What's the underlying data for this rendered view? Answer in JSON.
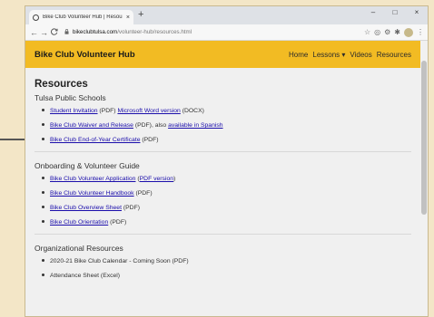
{
  "browser": {
    "tab_title": "Bike Club Volunteer Hub | Resou",
    "tab_close": "×",
    "new_tab": "+",
    "url_host": "bikeclubtulsa.com",
    "url_path": "/volunteer-hub/resources.html",
    "controls": {
      "minimize": "–",
      "maximize": "□",
      "close": "×"
    },
    "nav": {
      "back": "←",
      "forward": "→",
      "reload": "C"
    },
    "icons": {
      "lock": "lock-icon",
      "star": "star-icon"
    }
  },
  "site": {
    "brand": "Bike Club Volunteer Hub",
    "menu": {
      "home": "Home",
      "lessons": "Lessons ▾",
      "videos": "Videos",
      "resources": "Resources"
    },
    "accent": "#f2bb23"
  },
  "page": {
    "title": "Resources",
    "sections": {
      "tps": {
        "heading": "Tulsa Public Schools",
        "items": [
          {
            "link": "Student Invitation",
            "mid": " (PDF) ",
            "link2": "Microsoft Word version",
            "tail": " (DOCX)"
          },
          {
            "link": "Bike Club Waiver and Release",
            "mid": " (PDF), also ",
            "link2": "available in Spanish",
            "tail": ""
          },
          {
            "link": "Bike Club End-of-Year Certificate",
            "mid": " (PDF)"
          }
        ]
      },
      "onboarding": {
        "heading": "Onboarding & Volunteer Guide",
        "items": [
          {
            "link": "Bike Club Volunteer Application",
            "mid": " (",
            "link2": "PDF version",
            "tail": ")"
          },
          {
            "link": "Bike Club Volunteer Handbook",
            "mid": " (PDF)"
          },
          {
            "link": "Bike Club Overview Sheet",
            "mid": " (PDF)"
          },
          {
            "link": "Bike Club Orientation",
            "mid": " (PDF)"
          }
        ]
      },
      "org": {
        "heading": "Organizational Resources",
        "items": [
          {
            "text": "2020-21 Bike Club Calendar - Coming Soon (PDF)"
          },
          {
            "text": "Attendance Sheet (Excel)"
          }
        ]
      }
    }
  }
}
